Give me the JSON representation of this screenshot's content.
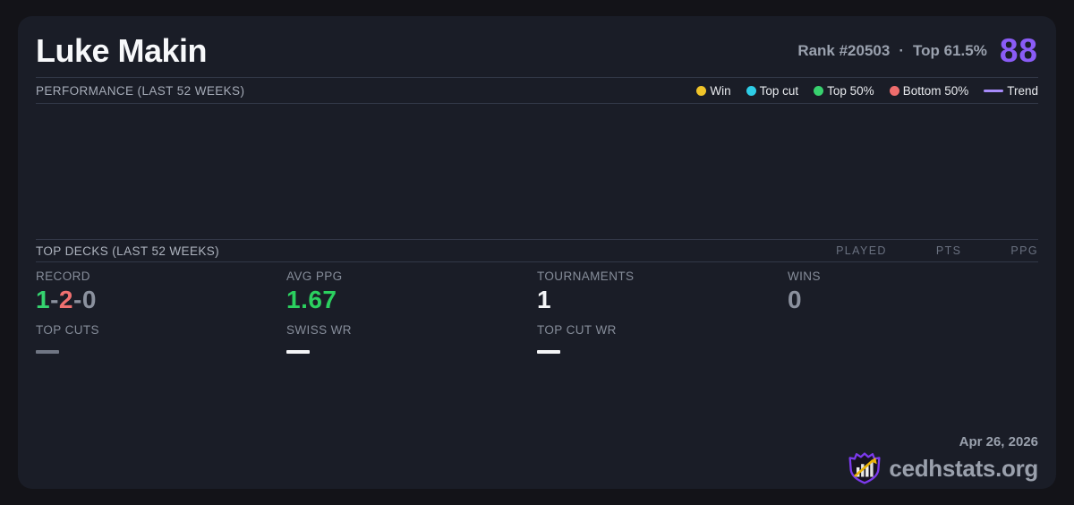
{
  "header": {
    "title": "Luke Makin",
    "rank_label": "Rank #20503",
    "separator": "·",
    "percentile_label": "Top 61.5%",
    "score": "88"
  },
  "performance": {
    "label": "PERFORMANCE (LAST 52 WEEKS)",
    "legend": [
      {
        "label": "Win",
        "type": "dot",
        "color_key": "win"
      },
      {
        "label": "Top cut",
        "type": "dot",
        "color_key": "top_cut"
      },
      {
        "label": "Top 50%",
        "type": "dot",
        "color_key": "top_50"
      },
      {
        "label": "Bottom 50%",
        "type": "dot",
        "color_key": "bottom_50"
      },
      {
        "label": "Trend",
        "type": "line",
        "color_key": "trend"
      }
    ]
  },
  "top_decks": {
    "label": "TOP DECKS (LAST 52 WEEKS)",
    "columns": [
      "PLAYED",
      "PTS",
      "PPG"
    ]
  },
  "stats": {
    "record": {
      "label": "RECORD",
      "wins": "1",
      "losses": "2",
      "draws": "0",
      "sep": "-"
    },
    "avg_ppg": {
      "label": "AVG PPG",
      "value": "1.67"
    },
    "tournaments": {
      "label": "TOURNAMENTS",
      "value": "1"
    },
    "wins": {
      "label": "WINS",
      "value": "0"
    },
    "top_cuts": {
      "label": "TOP CUTS",
      "value_empty": true
    },
    "swiss_wr": {
      "label": "SWISS WR",
      "value_empty": true
    },
    "top_cut_wr": {
      "label": "TOP CUT WR",
      "value_empty": true
    }
  },
  "footer": {
    "date": "Apr 26, 2026",
    "brand": "cedhstats.org"
  },
  "colors": {
    "win": "#f0c429",
    "top_cut": "#2ecde6",
    "top_50": "#38d16e",
    "bottom_50": "#ef6d6d",
    "trend": "#a78bfa",
    "accent_purple": "#8a5cf6",
    "record_win_green": "#35d36f",
    "record_loss_red": "#ef7070",
    "record_draw_gray": "#8b919e",
    "ppg_green": "#2bd05f",
    "dash_gray": "#707684"
  }
}
